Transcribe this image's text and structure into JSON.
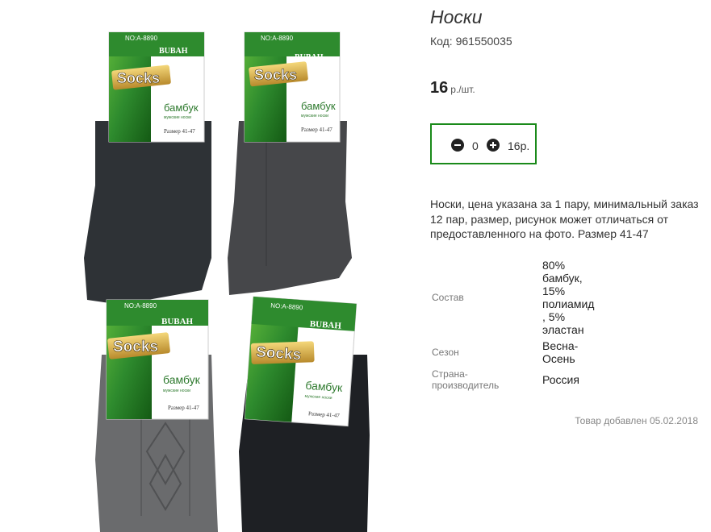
{
  "product": {
    "title": "Носки",
    "code_label": "Код:",
    "code_value": "961550035",
    "price_value": "16",
    "price_unit": "р./шт.",
    "description": "Носки, цена указана за 1 пару, минимальный заказ 12 пар, размер, рисунок может отличаться от предоставленного на фото. Размер 41-47",
    "added": "Товар добавлен 05.02.2018"
  },
  "quantity": {
    "value": "0",
    "total": "16р."
  },
  "properties": [
    {
      "label": "Состав",
      "value": "80% бамбук, 15% полиамид, 5% эластан"
    },
    {
      "label": "Сезон",
      "value": "Весна-Осень"
    },
    {
      "label": "Страна-производитель",
      "value": "Россия"
    }
  ],
  "photo": {
    "package_no": "NO:A-8890",
    "brand": "BUBAH",
    "socks_text": "Socks",
    "material": "бамбук",
    "subtitle": "мужские носки",
    "size_text": "Размер 41-47"
  },
  "colors": {
    "accent": "#1a8a1a",
    "sock_colors": [
      "#2e3236",
      "#46474a",
      "#6a6b6d",
      "#1e2024"
    ]
  }
}
